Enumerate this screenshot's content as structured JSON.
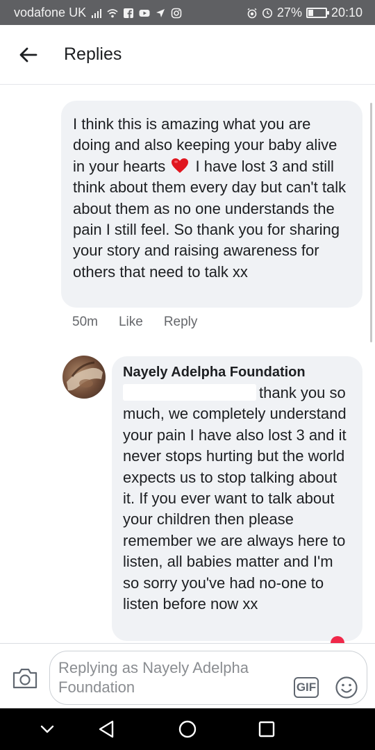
{
  "status_bar": {
    "carrier": "vodafone UK",
    "battery_percent": "27%",
    "battery_level": 0.27,
    "time": "20:10",
    "icons": [
      "signal-icon",
      "wifi-icon",
      "facebook-icon",
      "youtube-icon",
      "location-icon",
      "instagram-icon",
      "alarm-icon",
      "clock-icon",
      "battery-icon"
    ]
  },
  "header": {
    "title": "Replies",
    "back_icon": "arrow-left-icon"
  },
  "comment": {
    "text_before_emoji": "I think this is amazing what you are doing and also keeping your baby alive in your hearts",
    "emoji": "heart-emoji-icon",
    "text_after_emoji": "I have lost 3 and still think about them every day but can't talk about them as no one understands the pain I still feel. So thank you for sharing your story and raising awareness for others that need to talk xx",
    "time": "50m",
    "like_label": "Like",
    "reply_label": "Reply"
  },
  "reply": {
    "author": "Nayely Adelpha Foundation",
    "text": "thank you so much, we completely understand your pain I have also lost 3 and it never stops hurting but the world expects us to stop talking about it. If you ever want to talk about your children then please remember we are always here to listen, all babies matter and I'm so sorry you've had no-one to listen before now xx"
  },
  "composer": {
    "placeholder": "Replying as Nayely Adelpha Foundation",
    "gif_label": "GIF",
    "camera_icon": "camera-icon",
    "emoji_icon": "smiley-icon"
  },
  "navigation": {
    "icons": [
      "chevron-down-icon",
      "back-triangle-icon",
      "home-circle-icon",
      "recents-square-icon"
    ]
  },
  "colors": {
    "status_bar_bg": "#5f6063",
    "bubble_bg": "#f0f2f5",
    "text": "#1c1e21",
    "meta_text": "#65676b",
    "notification_red": "#f02849"
  }
}
